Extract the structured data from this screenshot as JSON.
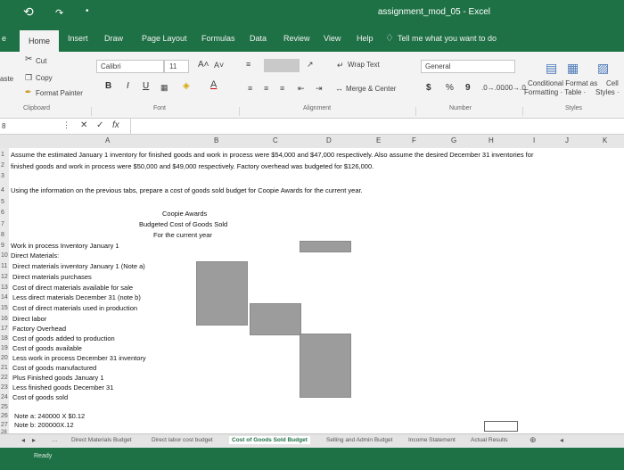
{
  "window": {
    "title": "assignment_mod_05  -  Excel"
  },
  "tabs": [
    "Home",
    "Insert",
    "Draw",
    "Page Layout",
    "Formulas",
    "Data",
    "Review",
    "View",
    "Help"
  ],
  "file_tab": "e",
  "tell_me": "Tell me what you want to do",
  "clipboard": {
    "cut": "Cut",
    "copy": "Copy",
    "paste": "aste",
    "format_painter": "Format Painter",
    "label": "Clipboard"
  },
  "font": {
    "name": "Calibri",
    "size": "11",
    "label": "Font",
    "bold": "B",
    "italic": "I",
    "underline": "U"
  },
  "alignment": {
    "wrap_text": "Wrap Text",
    "merge_center": "Merge & Center",
    "label": "Alignment"
  },
  "number": {
    "format": "General",
    "currency": "$",
    "percent": "%",
    "comma": "9",
    "label": "Number"
  },
  "styles": {
    "conditional": "Conditional  Format as",
    "formatting": "Formatting ·  Table ·",
    "cell": "Cell",
    "cell_styles": "Styles ·",
    "label": "Styles"
  },
  "formula_bar": {
    "name_box": "8",
    "fx": "fx"
  },
  "columns": [
    "A",
    "B",
    "C",
    "D",
    "E",
    "F",
    "G",
    "H",
    "I",
    "J",
    "K"
  ],
  "rows": [
    {
      "n": "1",
      "text": "Assume the estimated January 1 inventory for finished goods and work in process were $54,000 and $47,000 respectively. Also assume the desired December 31 inventories for"
    },
    {
      "n": "2",
      "text": "finished goods and work in process were $50,000 and $49,000 respectively. Factory overhead was budgeted for $126,000."
    },
    {
      "n": "3",
      "text": ""
    },
    {
      "n": "4",
      "text": "Using the information on the previous tabs, prepare a cost of goods sold budget for Coopie Awards for the current year."
    },
    {
      "n": "5",
      "text": ""
    },
    {
      "n": "6",
      "text": "Coopie Awards"
    },
    {
      "n": "7",
      "text": "Budgeted Cost of Goods Sold"
    },
    {
      "n": "8",
      "text": "For the current year"
    },
    {
      "n": "9",
      "text": "Work in process Inventory January 1"
    },
    {
      "n": "10",
      "text": "Direct Materials:"
    },
    {
      "n": "11",
      "text": "Direct materials inventory January 1 (Note a)"
    },
    {
      "n": "12",
      "text": "Direct materials purchases"
    },
    {
      "n": "13",
      "text": "Cost of direct materials available for sale"
    },
    {
      "n": "14",
      "text": "Less direct materials December 31 (note b)"
    },
    {
      "n": "15",
      "text": "Cost of direct materials used in production"
    },
    {
      "n": "16",
      "text": "Direct labor"
    },
    {
      "n": "17",
      "text": "Factory Overhead"
    },
    {
      "n": "18",
      "text": "Cost of goods added to production"
    },
    {
      "n": "19",
      "text": "Cost of goods available"
    },
    {
      "n": "20",
      "text": "Less work in process December 31 inventory"
    },
    {
      "n": "21",
      "text": "Cost of goods manufactured"
    },
    {
      "n": "22",
      "text": "Plus Finished goods January 1"
    },
    {
      "n": "23",
      "text": "Less finished goods December 31"
    },
    {
      "n": "24",
      "text": "Cost of goods sold"
    },
    {
      "n": "25",
      "text": ""
    },
    {
      "n": "26",
      "text": "Note a: 240000 X $0.12"
    },
    {
      "n": "27",
      "text": "Note b: 200000X.12"
    },
    {
      "n": "28",
      "text": ""
    }
  ],
  "sheet_tabs": [
    "Direct Materials Budget",
    "Direct labor cost budget",
    "Cost of Goods Sold Budget",
    "Selling and Admin Budget",
    "Income Statement",
    "Actual Results"
  ],
  "status": "Ready"
}
